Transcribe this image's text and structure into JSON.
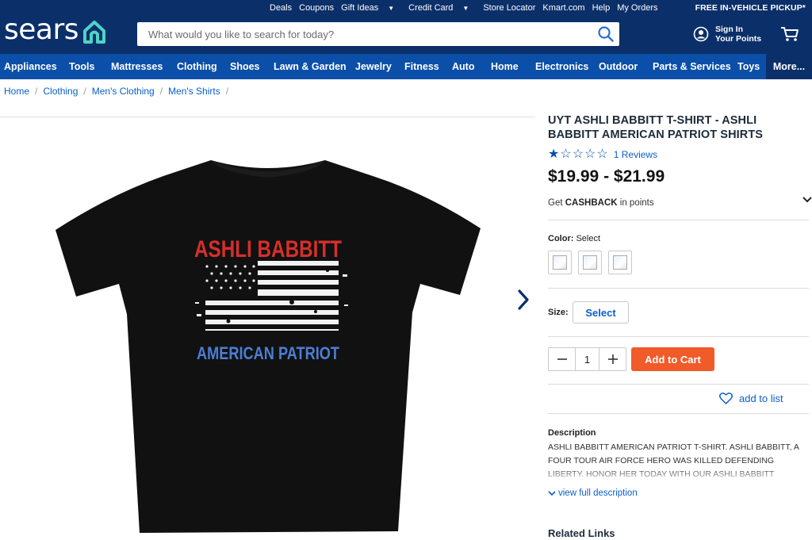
{
  "header": {
    "util_links": [
      {
        "label": "Deals",
        "dropdown": false
      },
      {
        "label": "Coupons",
        "dropdown": false
      },
      {
        "label": "Gift Ideas",
        "dropdown": true
      },
      {
        "label": "Credit Card",
        "dropdown": true
      },
      {
        "label": "Store Locator",
        "dropdown": false
      },
      {
        "label": "Kmart.com",
        "dropdown": false
      },
      {
        "label": "Help",
        "dropdown": false
      },
      {
        "label": "My Orders",
        "dropdown": false
      }
    ],
    "pickup_banner": "FREE IN-VEHICLE PICKUP*",
    "logo_text": "sears",
    "search_placeholder": "What would you like to search for today?",
    "signin_line1": "Sign In",
    "signin_line2": "Your Points"
  },
  "categories": [
    "Appliances",
    "Tools",
    "Mattresses",
    "Clothing",
    "Shoes",
    "Lawn & Garden",
    "Jewelry",
    "Fitness",
    "Auto",
    "Home",
    "Electronics",
    "Outdoor",
    "Parts & Services",
    "Toys",
    "More..."
  ],
  "breadcrumb": [
    "Home",
    "Clothing",
    "Men's Clothing",
    "Men's Shirts"
  ],
  "product": {
    "title": "UYT ASHLI BABBITT T-SHIRT - ASHLI BABBITT AMERICAN PATRIOT SHIRTS",
    "rating": 1,
    "rating_max": 5,
    "reviews_label": "1 Reviews",
    "price": "$19.99 - $21.99",
    "cashback_prefix": "Get",
    "cashback_bold": "CASHBACK",
    "cashback_suffix": "in points",
    "color_label": "Color:",
    "color_value": "Select",
    "swatch_count": 3,
    "size_label": "Size:",
    "size_button": "Select",
    "quantity": "1",
    "add_to_cart": "Add to Cart",
    "add_to_list": "add to list",
    "description_heading": "Description",
    "description_text": "ASHLI BABBITT AMERICAN PATRIOT T-SHIRT. ASHLI BABBITT, A FOUR TOUR AIR FORCE HERO WAS KILLED DEFENDING LIBERTY. HONOR HER TODAY WITH OUR ASHLI BABBITT AMERICAN...",
    "view_full": "view full description",
    "related_links": "Related Links",
    "shirt_print_top": "ASHLI BABBITT",
    "shirt_print_bottom": "AMERICAN PATRIOT"
  },
  "colors": {
    "header_bg": "#0b2f69",
    "nav_bg": "#0b4fa8",
    "link": "#0b5fc9",
    "cta": "#f15a29",
    "logo_accent": "#4dd4c4",
    "shirt": "#111111",
    "print_red": "#d62f2a",
    "print_blue": "#4a7fd6"
  }
}
